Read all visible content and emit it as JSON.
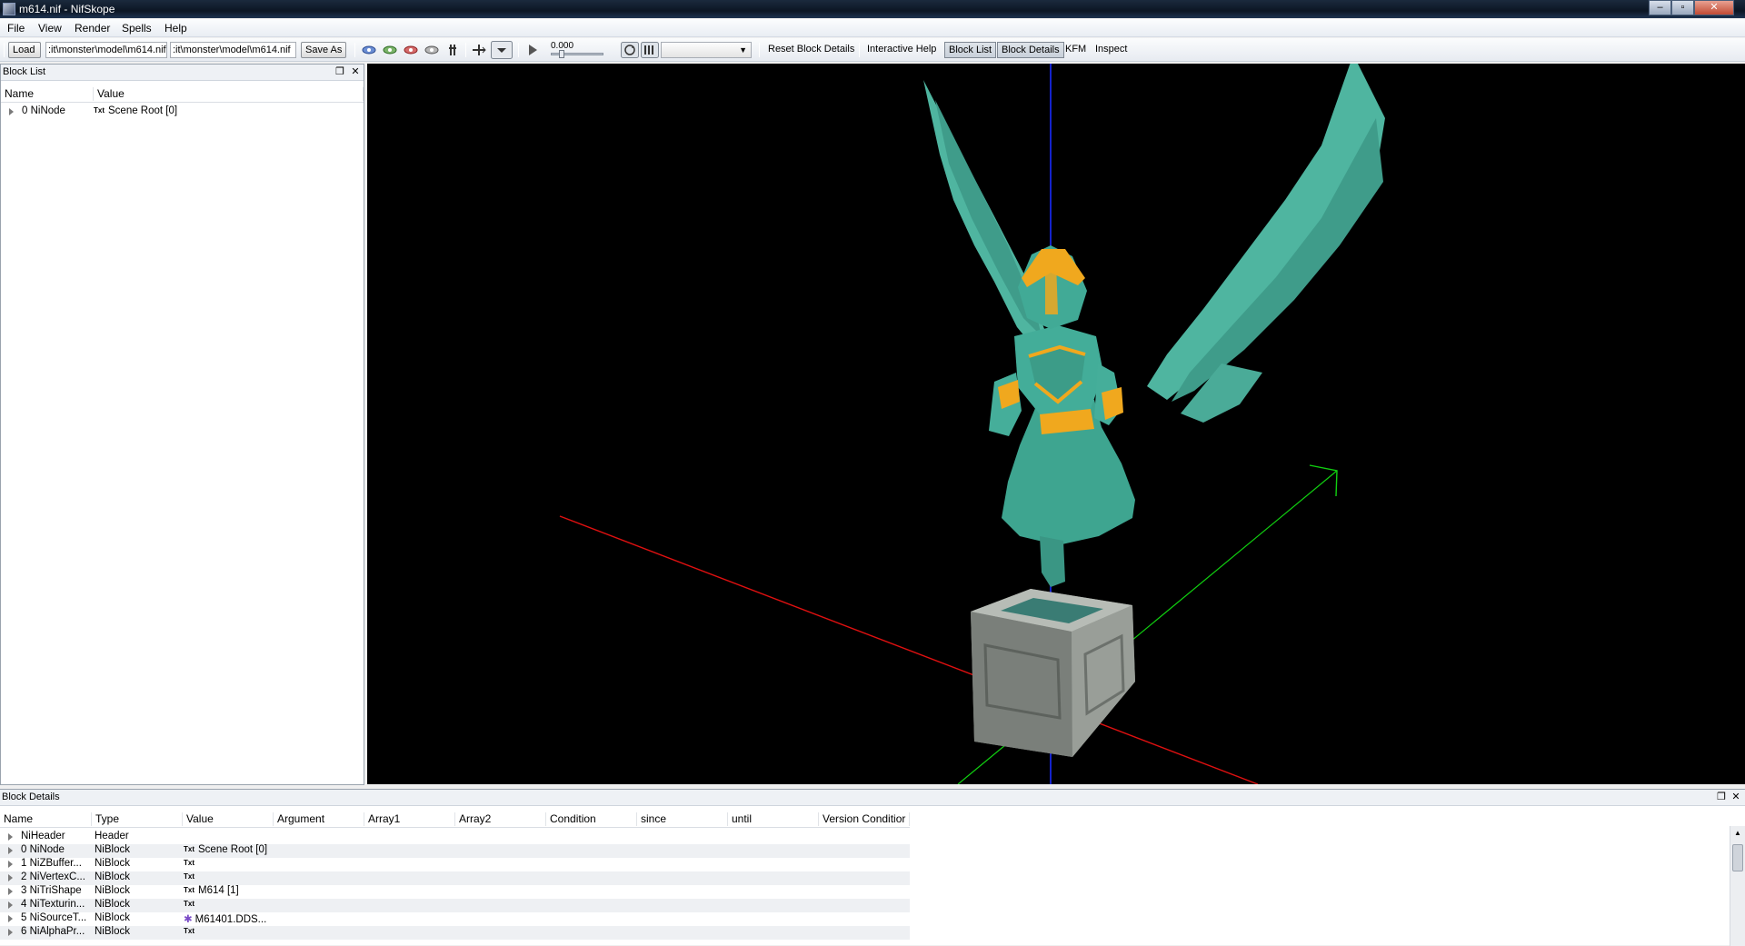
{
  "window": {
    "title": "m614.nif - NifSkope"
  },
  "menu": [
    "File",
    "View",
    "Render",
    "Spells",
    "Help"
  ],
  "toolbar": {
    "load": "Load",
    "file1": ":it\\monster\\model\\m614.nif",
    "file2": ":it\\monster\\model\\m614.nif",
    "save_as": "Save As",
    "time": "0.000",
    "reset_block_details": "Reset Block Details",
    "interactive_help": "Interactive Help",
    "block_list": "Block List",
    "block_details": "Block Details",
    "kfm": "KFM",
    "inspect": "Inspect"
  },
  "block_list": {
    "title": "Block List",
    "columns": [
      "Name",
      "Value"
    ],
    "rows": [
      {
        "name": "0 NiNode",
        "tag": "Txt",
        "value": "Scene Root [0]"
      }
    ]
  },
  "block_details": {
    "title": "Block Details",
    "columns": [
      "Name",
      "Type",
      "Value",
      "Argument",
      "Array1",
      "Array2",
      "Condition",
      "since",
      "until",
      "Version Conditior"
    ],
    "rows": [
      {
        "name": "NiHeader",
        "type": "Header",
        "tag": "",
        "value": ""
      },
      {
        "name": "0 NiNode",
        "type": "NiBlock",
        "tag": "Txt",
        "value": "Scene Root [0]"
      },
      {
        "name": "1 NiZBuffer...",
        "type": "NiBlock",
        "tag": "Txt",
        "value": ""
      },
      {
        "name": "2 NiVertexC...",
        "type": "NiBlock",
        "tag": "Txt",
        "value": ""
      },
      {
        "name": "3 NiTriShape",
        "type": "NiBlock",
        "tag": "Txt",
        "value": "M614 [1]"
      },
      {
        "name": "4 NiTexturin...",
        "type": "NiBlock",
        "tag": "Txt",
        "value": ""
      },
      {
        "name": "5 NiSourceT...",
        "type": "NiBlock",
        "tag": "",
        "value": "M61401.DDS..."
      },
      {
        "name": "6 NiAlphaPr...",
        "type": "NiBlock",
        "tag": "Txt",
        "value": ""
      }
    ]
  }
}
